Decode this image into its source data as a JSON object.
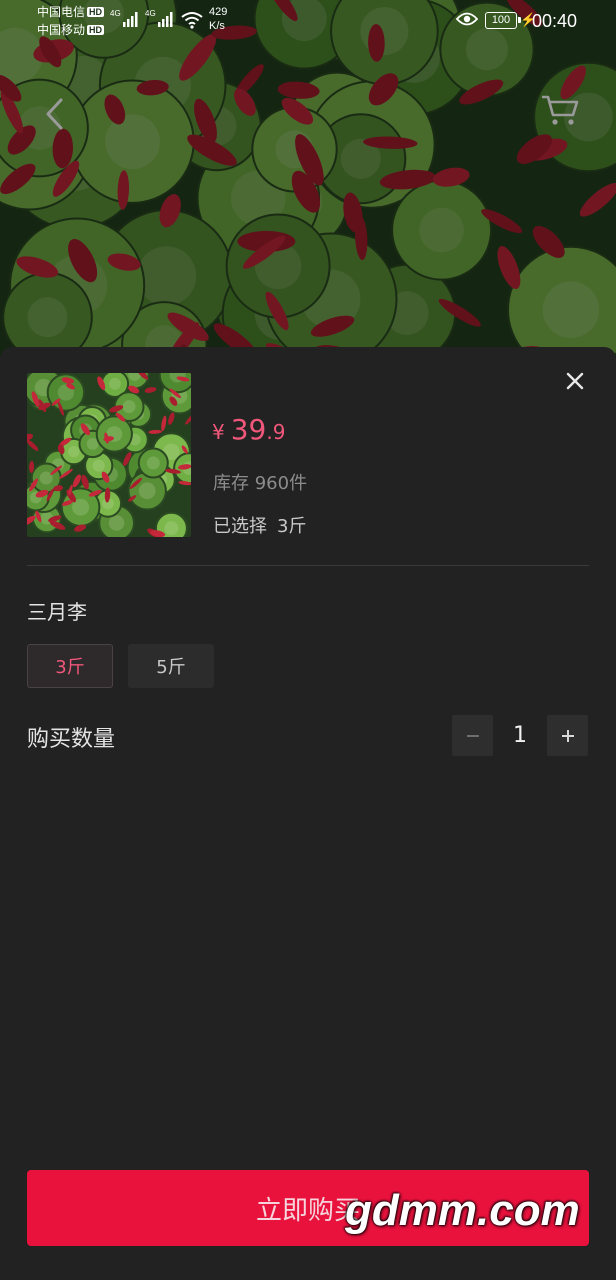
{
  "status_bar": {
    "carrier_1": "中国电信",
    "carrier_2": "中国移动",
    "hd_badge": "HD",
    "network_gen": "4G",
    "net_speed_value": "429",
    "net_speed_unit": "K/s",
    "battery": "100",
    "time": "00:40"
  },
  "nav": {
    "back_icon": "chevron-left-icon",
    "cart_icon": "shopping-cart-icon"
  },
  "product": {
    "currency": "¥",
    "price_int": "39",
    "price_dec": ".9",
    "stock_label": "库存",
    "stock_value": "960件",
    "selected_label": "已选择",
    "selected_value": "3斤"
  },
  "spec": {
    "title": "三月李",
    "options": [
      {
        "label": "3斤",
        "selected": true
      },
      {
        "label": "5斤",
        "selected": false
      }
    ]
  },
  "quantity": {
    "label": "购买数量",
    "value": "1"
  },
  "buy_button_label": "立即购买",
  "watermark": "gdmm.com",
  "colors": {
    "accent": "#f0577a",
    "buy_button": "#e8123d",
    "sheet_bg": "#222222"
  }
}
